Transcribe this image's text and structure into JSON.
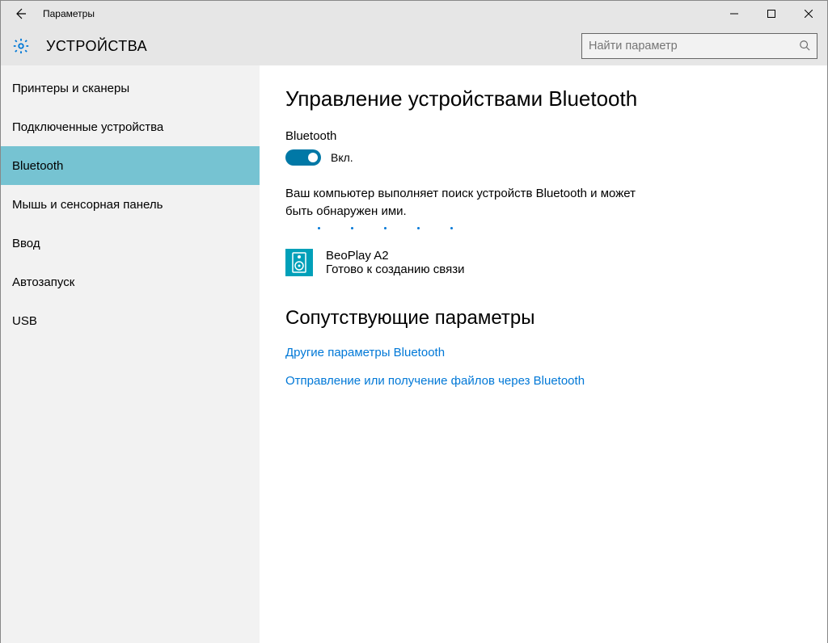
{
  "window": {
    "title": "Параметры"
  },
  "header": {
    "section": "УСТРОЙСТВА",
    "search_placeholder": "Найти параметр"
  },
  "sidebar": {
    "items": [
      {
        "label": "Принтеры и сканеры",
        "selected": false
      },
      {
        "label": "Подключенные устройства",
        "selected": false
      },
      {
        "label": "Bluetooth",
        "selected": true
      },
      {
        "label": "Мышь и сенсорная панель",
        "selected": false
      },
      {
        "label": "Ввод",
        "selected": false
      },
      {
        "label": "Автозапуск",
        "selected": false
      },
      {
        "label": "USB",
        "selected": false
      }
    ]
  },
  "main": {
    "heading": "Управление устройствами Bluetooth",
    "bt_label": "Bluetooth",
    "toggle_state": "Вкл.",
    "status": "Ваш компьютер выполняет поиск устройств Bluetooth и может быть обнаружен ими.",
    "device": {
      "name": "BeoPlay A2",
      "state": "Готово к созданию связи"
    },
    "related_heading": "Сопутствующие параметры",
    "links": [
      "Другие параметры Bluetooth",
      "Отправление или получение файлов через Bluetooth"
    ]
  }
}
